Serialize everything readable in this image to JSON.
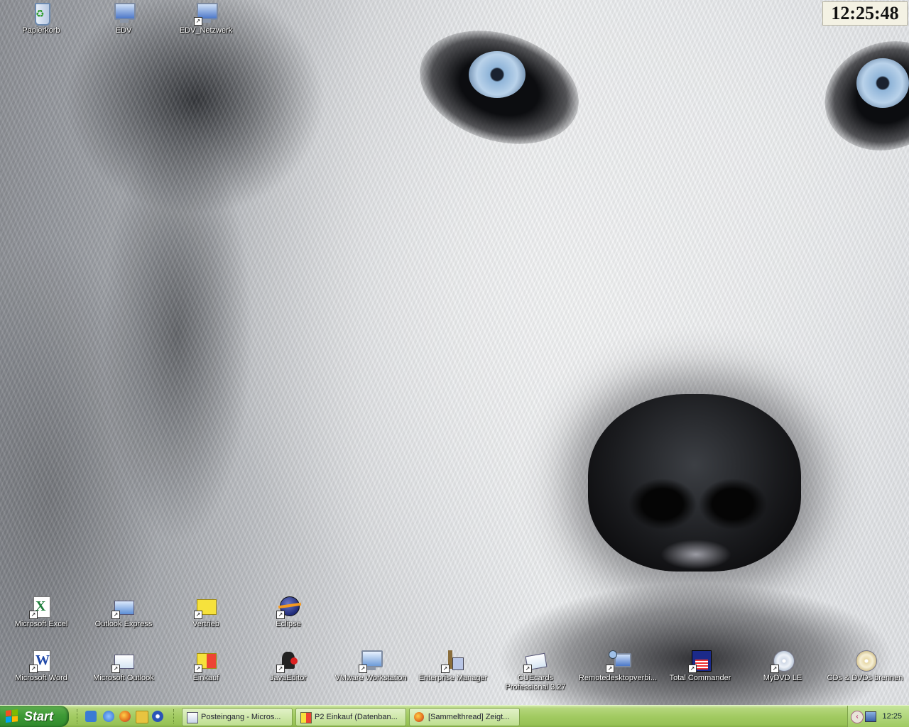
{
  "clock": {
    "time": "12:25:48"
  },
  "desktop_icons_top": [
    {
      "id": "papierkorb",
      "label": "Papierkorb",
      "icon": "recycle-bin-icon"
    },
    {
      "id": "edv",
      "label": "EDV",
      "icon": "network-computer-icon"
    },
    {
      "id": "edv-netzwerk",
      "label": "EDV_Netzwerk",
      "icon": "network-computer-icon"
    }
  ],
  "desktop_icons_row1": [
    {
      "id": "excel",
      "label": "Microsoft Excel",
      "icon": "excel-icon"
    },
    {
      "id": "outlook-express",
      "label": "Outlook Express",
      "icon": "outlook-express-icon"
    },
    {
      "id": "vertrieb",
      "label": "Vertrieb",
      "icon": "folder-icon"
    },
    {
      "id": "eclipse",
      "label": "Eclipse",
      "icon": "eclipse-icon"
    }
  ],
  "desktop_icons_row2": [
    {
      "id": "word",
      "label": "Microsoft Word",
      "icon": "word-icon"
    },
    {
      "id": "outlook",
      "label": "Microsoft Outlook",
      "icon": "outlook-icon"
    },
    {
      "id": "einkauf",
      "label": "Einkauf",
      "icon": "folder-icon"
    },
    {
      "id": "javaeditor",
      "label": "JavaEditor",
      "icon": "java-editor-icon"
    },
    {
      "id": "vmware",
      "label": "VMware Workstation",
      "icon": "vmware-icon"
    },
    {
      "id": "enterprise-manager",
      "label": "Enterprise Manager",
      "icon": "enterprise-manager-icon"
    },
    {
      "id": "cuecards",
      "label": "CUEcards Professional 3.27",
      "icon": "cuecards-icon"
    },
    {
      "id": "remotedesktop",
      "label": "Remotedesktopverbi...",
      "icon": "remote-desktop-icon"
    },
    {
      "id": "total-commander",
      "label": "Total Commander",
      "icon": "floppy-icon"
    },
    {
      "id": "mydvd",
      "label": "MyDVD LE",
      "icon": "dvd-icon"
    },
    {
      "id": "cds-dvds",
      "label": "CDs & DVDs brennen",
      "icon": "cd-burn-icon"
    }
  ],
  "taskbar": {
    "start_label": "Start",
    "quick_launch": [
      {
        "id": "ql-1",
        "icon": "outlook-express-icon",
        "color": "#3a7bd5"
      },
      {
        "id": "ql-2",
        "icon": "internet-explorer-icon",
        "color": "#2b6cd0"
      },
      {
        "id": "ql-3",
        "icon": "firefox-icon",
        "color": "#e36f1c"
      },
      {
        "id": "ql-4",
        "icon": "folder-icon",
        "color": "#e8c440"
      },
      {
        "id": "ql-5",
        "icon": "media-player-icon",
        "color": "#2a54b8"
      }
    ],
    "tasks": [
      {
        "id": "task-posteingang",
        "label": "Posteingang - Micros...",
        "icon": "outlook-icon"
      },
      {
        "id": "task-einkauf",
        "label": "P2 Einkauf (Datenban...",
        "icon": "access-database-icon"
      },
      {
        "id": "task-sammelthread",
        "label": "[Sammelthread] Zeigt...",
        "icon": "firefox-icon"
      }
    ],
    "tray_time": "12:25"
  }
}
